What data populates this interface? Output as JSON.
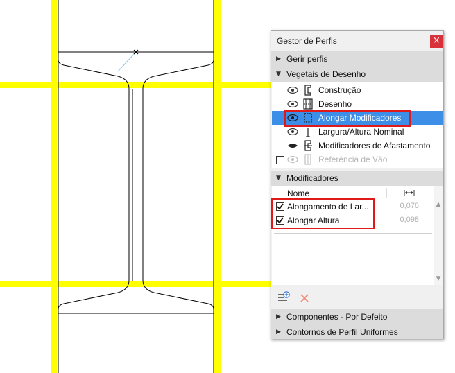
{
  "panel": {
    "title": "Gestor de Perfis",
    "close_glyph": "×"
  },
  "sections": {
    "manage": {
      "label": "Gerir perfis",
      "expanded": false
    },
    "layers": {
      "label": "Vegetais de Desenho",
      "expanded": true
    },
    "modifiers": {
      "label": "Modificadores",
      "expanded": true
    },
    "components": {
      "label": "Componentes - Por Defeito",
      "expanded": false
    },
    "contours": {
      "label": "Contornos de Perfil Uniformes",
      "expanded": false
    }
  },
  "layers": [
    {
      "label": "Construção",
      "icon": "construction-icon",
      "visible": true,
      "selected": false,
      "disabled": false
    },
    {
      "label": "Desenho",
      "icon": "drawing-icon",
      "visible": true,
      "selected": false,
      "disabled": false
    },
    {
      "label": "Alongar Modificadores",
      "icon": "stretch-modifiers-icon",
      "visible": true,
      "selected": true,
      "disabled": false
    },
    {
      "label": "Largura/Altura Nominal",
      "icon": "nominal-size-icon",
      "visible": true,
      "selected": false,
      "disabled": false
    },
    {
      "label": "Modificadores de Afastamento",
      "icon": "offset-modifiers-icon",
      "visible": true,
      "selected": false,
      "disabled": false
    },
    {
      "label": "Referência de Vão",
      "icon": "span-reference-icon",
      "visible": true,
      "selected": false,
      "disabled": true
    }
  ],
  "modifiers_table": {
    "column_name": "Nome",
    "column_value_icon": "width-arrows-icon",
    "rows": [
      {
        "label": "Alongamento de Lar...",
        "value": "0,076",
        "checked": true
      },
      {
        "label": "Alongar Altura",
        "value": "0,098",
        "checked": true
      }
    ]
  },
  "colors": {
    "grid_yellow": "#ffff00",
    "selection_blue": "#3d8ee7",
    "highlight_red": "#e01a1a",
    "close_red": "#d9313a"
  }
}
